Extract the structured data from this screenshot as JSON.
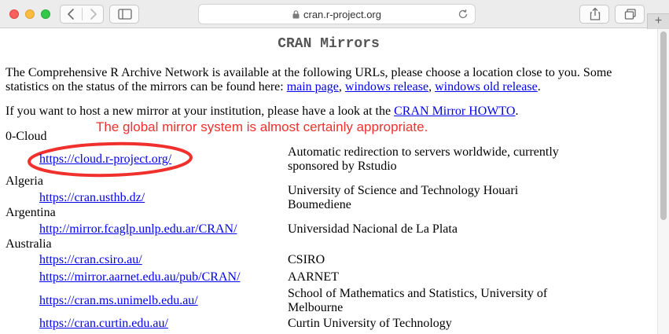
{
  "browser": {
    "url": "cran.r-project.org",
    "new_tab": "+"
  },
  "page": {
    "title": "CRAN Mirrors",
    "intro_text": "The Comprehensive R Archive Network is available at the following URLs, please choose a location close to you. Some statistics on the status of the mirrors can be found here: ",
    "intro_links": [
      "main page",
      "windows release",
      "windows old release"
    ],
    "intro_sep1": ", ",
    "intro_sep2": ", ",
    "intro_end": ".",
    "host_text": "If you want to host a new mirror at your institution, please have a look at the ",
    "host_link": "CRAN Mirror HOWTO",
    "host_end": ".",
    "annotation": "The global mirror system is almost certainly appropriate.",
    "annotation_color": "#f0302c",
    "link_color": "#0000ee"
  },
  "mirrors": {
    "countries": [
      "0-Cloud",
      "Algeria",
      "Argentina",
      "Australia"
    ],
    "entries": [
      {
        "url": "https://cloud.r-project.org/",
        "desc": "Automatic redirection to servers worldwide, currently sponsored by Rstudio"
      },
      {
        "url": "https://cran.usthb.dz/",
        "desc": "University of Science and Technology Houari Boumediene"
      },
      {
        "url": "http://mirror.fcaglp.unlp.edu.ar/CRAN/",
        "desc": "Universidad Nacional de La Plata"
      },
      {
        "url": "https://cran.csiro.au/",
        "desc": "CSIRO"
      },
      {
        "url": "https://mirror.aarnet.edu.au/pub/CRAN/",
        "desc": "AARNET"
      },
      {
        "url": "https://cran.ms.unimelb.edu.au/",
        "desc": "School of Mathematics and Statistics, University of Melbourne"
      },
      {
        "url": "https://cran.curtin.edu.au/",
        "desc": "Curtin University of Technology"
      }
    ]
  }
}
